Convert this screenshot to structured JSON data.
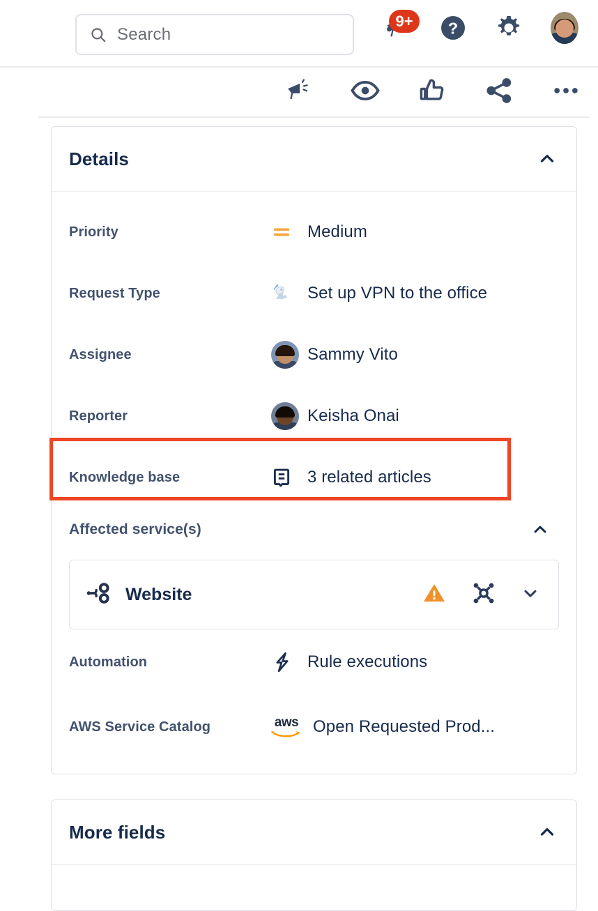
{
  "header": {
    "search": {
      "placeholder": "Search",
      "value": "",
      "icon": "search-icon"
    },
    "notifications": {
      "icon": "notification-bell-icon",
      "badge": "9+",
      "badge_color": "#de3618"
    },
    "help": {
      "icon": "help-circle-icon",
      "label": "Help"
    },
    "settings": {
      "icon": "gear-icon",
      "label": "Settings"
    },
    "profile": {
      "icon": "avatar",
      "label": "Your profile"
    }
  },
  "action_bar": {
    "items": [
      {
        "name": "announce-icon",
        "label": "Announce"
      },
      {
        "name": "eye-icon",
        "label": "Watch"
      },
      {
        "name": "thumbs-up-icon",
        "label": "Like"
      },
      {
        "name": "share-icon",
        "label": "Share"
      },
      {
        "name": "more-actions-icon",
        "label": "More actions"
      }
    ]
  },
  "details": {
    "title": "Details",
    "collapse_icon": "chevron-up-icon",
    "fields": [
      {
        "label": "Priority",
        "value": "Medium",
        "icon": "priority-medium-icon",
        "icon_color": "#f5a43c"
      },
      {
        "label": "Request Type",
        "value": "Set up VPN to the office",
        "icon": "satellite-dish-icon"
      },
      {
        "label": "Assignee",
        "value": "Sammy Vito",
        "icon": "user-avatar"
      },
      {
        "label": "Reporter",
        "value": "Keisha Onai",
        "icon": "user-avatar"
      },
      {
        "label": "Knowledge base",
        "value": "3 related articles",
        "icon": "knowledge-base-book-icon",
        "highlighted": true,
        "highlight_color": "#ef4524"
      }
    ],
    "affected_services": {
      "title": "Affected service(s)",
      "collapse_icon": "chevron-up-icon",
      "services": [
        {
          "name": "Website",
          "icon": "service-tree-icon",
          "status_icon": "warning-triangle-icon",
          "status_color": "#f0912a",
          "topology_icon": "service-topology-icon",
          "expand_icon": "chevron-down-icon"
        }
      ]
    },
    "extra_fields": [
      {
        "label": "Automation",
        "value": "Rule executions",
        "icon": "lightning-bolt-icon"
      },
      {
        "label": "AWS Service Catalog",
        "value": "Open Requested Prod...",
        "icon": "aws-logo",
        "icon_text": "aws"
      }
    ]
  },
  "more_fields": {
    "title": "More fields",
    "collapse_icon": "chevron-up-icon"
  },
  "colors": {
    "text_primary": "#172b4d",
    "text_label": "#42526e",
    "border": "#dfe1e6",
    "accent_red": "#ef4524",
    "accent_orange": "#f5a43c",
    "badge_red": "#de3618"
  }
}
